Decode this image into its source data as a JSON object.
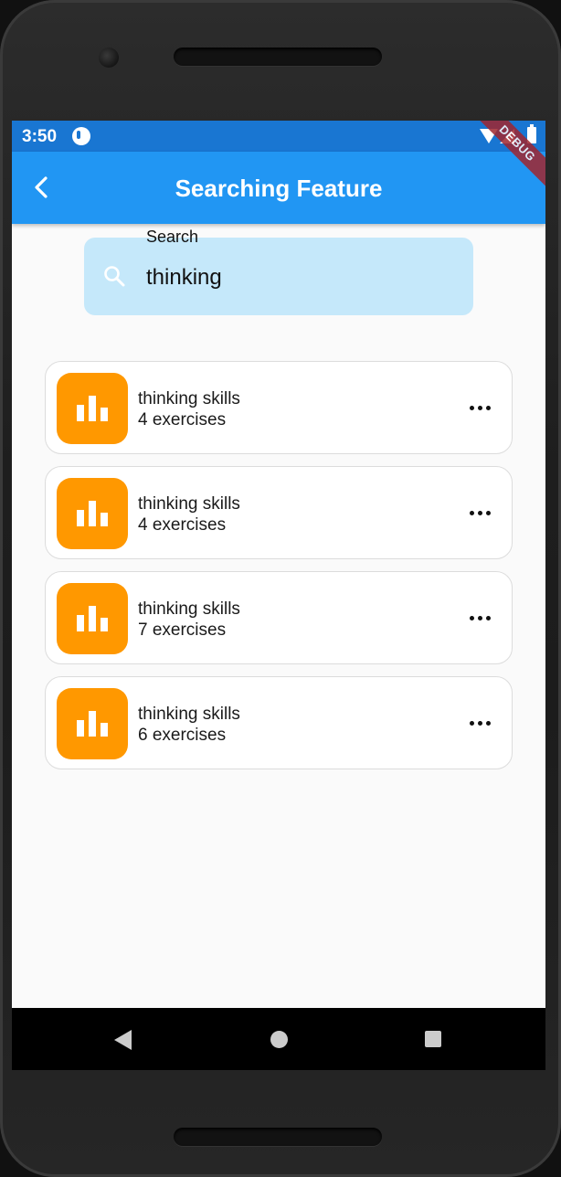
{
  "status_bar": {
    "time": "3:50"
  },
  "debug_banner": "DEBUG",
  "app_bar": {
    "title": "Searching Feature"
  },
  "search": {
    "label": "Search",
    "value": "thinking"
  },
  "results": [
    {
      "title": "thinking skills",
      "subtitle": "4 exercises"
    },
    {
      "title": "thinking skills",
      "subtitle": "4 exercises"
    },
    {
      "title": "thinking skills",
      "subtitle": "7 exercises"
    },
    {
      "title": "thinking skills",
      "subtitle": "6 exercises"
    }
  ],
  "icons": {
    "back": "arrow-back-icon",
    "search": "search-icon",
    "item": "bar-chart-icon",
    "more": "more-horiz-icon"
  },
  "colors": {
    "status_bar": "#1976d2",
    "app_bar": "#2196f3",
    "search_field": "#c5e8fa",
    "item_icon": "#ff9800",
    "debug_banner": "#a0262f"
  }
}
